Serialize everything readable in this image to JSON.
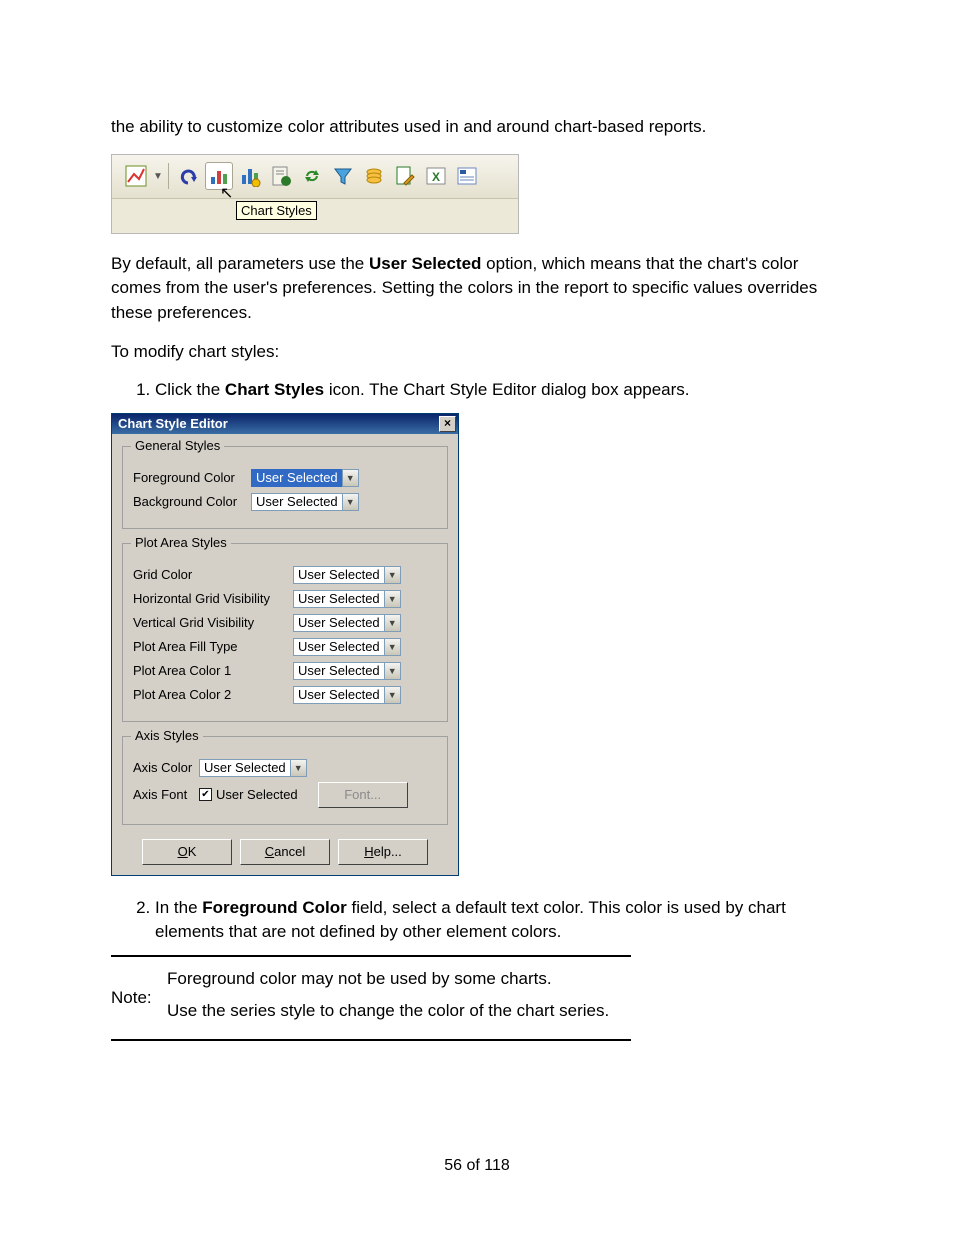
{
  "intro_text": "the ability to customize color attributes used in and around chart-based reports.",
  "toolbar": {
    "tooltip": "Chart Styles",
    "icons": [
      "chart-type-icon",
      "dropdown-icon",
      "undo-icon",
      "chart-styles-icon",
      "series-style-icon",
      "report-options-icon",
      "refresh-icon",
      "filter-icon",
      "coin-stack-icon",
      "edit-page-icon",
      "export-excel-icon",
      "view-list-icon"
    ]
  },
  "para2_pre": "By default, all parameters use the ",
  "para2_bold": "User Selected",
  "para2_post": " option, which means that the chart's color comes from the user's preferences. Setting the colors in the report to specific values overrides these preferences.",
  "para3": "To modify chart styles:",
  "step1_pre": "Click the ",
  "step1_bold": "Chart Styles",
  "step1_post": " icon. The Chart Style Editor dialog box appears.",
  "dialog": {
    "title": "Chart Style Editor",
    "groups": {
      "general": {
        "legend": "General Styles",
        "rows": [
          {
            "label": "Foreground Color",
            "value": "User Selected",
            "selected": true
          },
          {
            "label": "Background Color",
            "value": "User Selected",
            "selected": false
          }
        ]
      },
      "plot": {
        "legend": "Plot Area Styles",
        "rows": [
          {
            "label": "Grid Color",
            "value": "User Selected"
          },
          {
            "label": "Horizontal Grid Visibility",
            "value": "User Selected"
          },
          {
            "label": "Vertical Grid Visibility",
            "value": "User Selected"
          },
          {
            "label": "Plot Area Fill Type",
            "value": "User Selected"
          },
          {
            "label": "Plot Area Color 1",
            "value": "User Selected"
          },
          {
            "label": "Plot Area Color 2",
            "value": "User Selected"
          }
        ]
      },
      "axis": {
        "legend": "Axis Styles",
        "color_row": {
          "label": "Axis Color",
          "value": "User Selected"
        },
        "font_row": {
          "label": "Axis Font",
          "checkbox_label": "User Selected",
          "button": "Font..."
        }
      }
    },
    "buttons": {
      "ok": "OK",
      "cancel": "Cancel",
      "help": "Help..."
    }
  },
  "step2_pre": "In the ",
  "step2_bold": "Foreground Color",
  "step2_post": " field, select a default text color. This color is used by chart elements that are not defined by other element colors.",
  "note": {
    "label": "Note:",
    "line1": "Foreground color may not be used by some charts.",
    "line2": "Use the series style to change the color of the chart series."
  },
  "footer": "56 of 118"
}
